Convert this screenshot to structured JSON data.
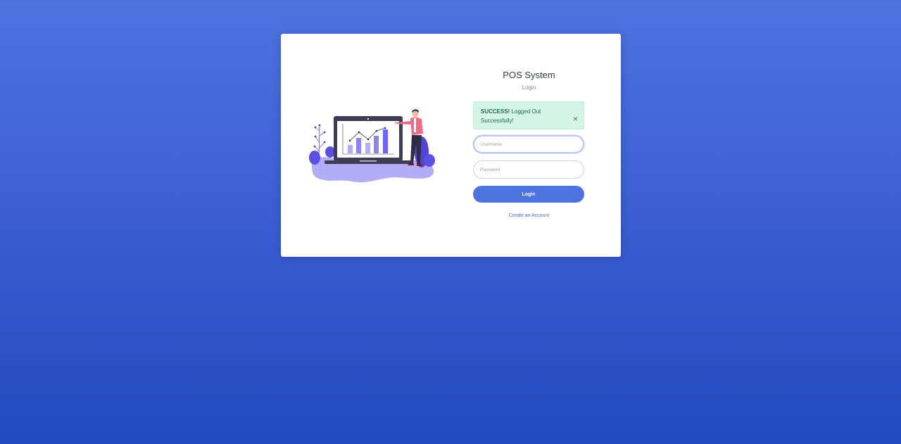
{
  "app": {
    "title": "POS System",
    "subtitle": "Login"
  },
  "alert": {
    "type": "success",
    "strong": "SUCCESS!",
    "message": " Logged Out Successfully!",
    "close_glyph": "×"
  },
  "form": {
    "username_placeholder": "Username",
    "password_placeholder": "Password",
    "login_label": "Login",
    "create_account_label": "Create an Account"
  },
  "colors": {
    "primary": "#4e73df",
    "background_top": "#4e73df",
    "background_bottom": "#224abe",
    "success_bg": "#d4f5e6",
    "illustration_purple": "#6c63ff",
    "illustration_accent": "#f06a82"
  },
  "illustration": {
    "icon": "analytics-presentation-illustration"
  }
}
